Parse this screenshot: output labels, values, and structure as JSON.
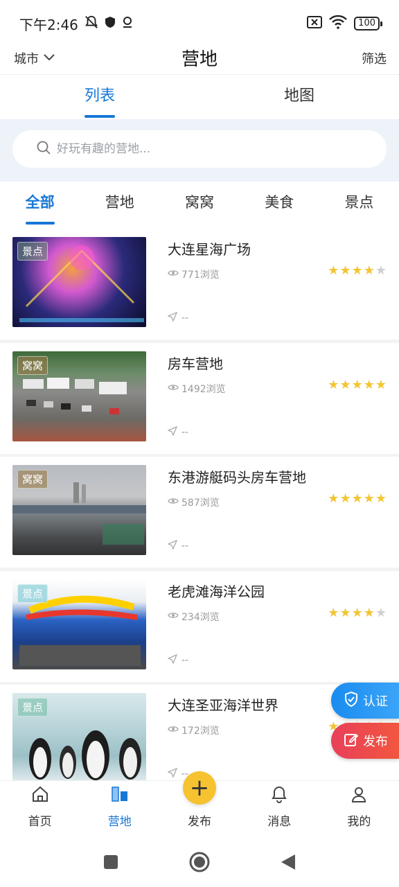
{
  "status_bar": {
    "time": "下午2:46",
    "battery": "100"
  },
  "header": {
    "city": "城市",
    "title": "营地",
    "filter": "筛选"
  },
  "view_tabs": [
    {
      "label": "列表"
    },
    {
      "label": "地图"
    }
  ],
  "search": {
    "placeholder": "好玩有趣的营地..."
  },
  "categories": [
    {
      "label": "全部"
    },
    {
      "label": "营地"
    },
    {
      "label": "窝窝"
    },
    {
      "label": "美食"
    },
    {
      "label": "景点"
    }
  ],
  "items": [
    {
      "title": "大连星海广场",
      "tag": "景点",
      "views": "771浏览",
      "rating": 4,
      "distance": "--"
    },
    {
      "title": "房车营地",
      "tag": "窝窝",
      "views": "1492浏览",
      "rating": 5,
      "distance": "--"
    },
    {
      "title": "东港游艇码头房车营地",
      "tag": "窝窝",
      "views": "587浏览",
      "rating": 5,
      "distance": "--"
    },
    {
      "title": "老虎滩海洋公园",
      "tag": "景点",
      "views": "234浏览",
      "rating": 4,
      "distance": "--"
    },
    {
      "title": "大连圣亚海洋世界",
      "tag": "景点",
      "views": "172浏览",
      "rating": 5,
      "distance": "--"
    }
  ],
  "float_buttons": {
    "certify": "认证",
    "post": "发布"
  },
  "bottom_nav": [
    {
      "label": "首页"
    },
    {
      "label": "营地"
    },
    {
      "label": "发布"
    },
    {
      "label": "消息"
    },
    {
      "label": "我的"
    }
  ],
  "colors": {
    "accent": "#1677d6",
    "star": "#f3c531",
    "publish": "#f6c22f"
  }
}
